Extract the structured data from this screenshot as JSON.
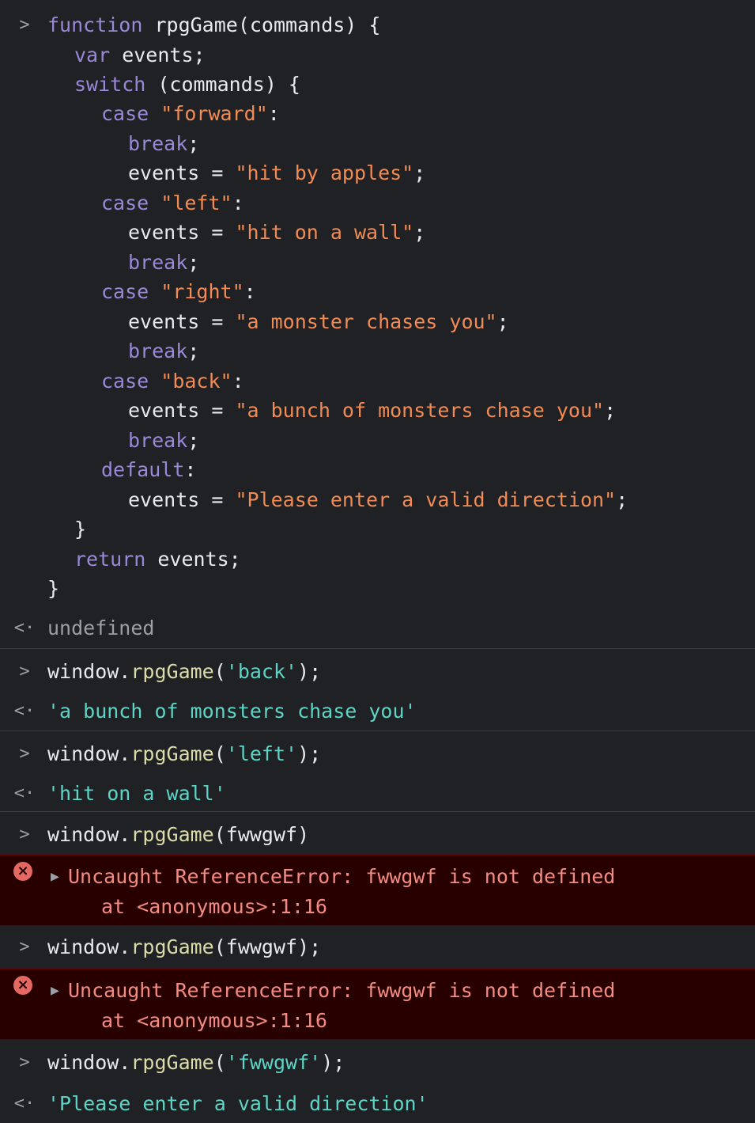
{
  "prompt_symbol": ">",
  "result_symbol": "<·",
  "error_icon": "×",
  "expand_triangle": "▶",
  "func": {
    "l0": {
      "kw": "function",
      "rest": " rpgGame(commands) {"
    },
    "l1": {
      "kw": "var",
      "rest": " events;"
    },
    "l2": {
      "kw": "switch",
      "rest": " (commands) {"
    },
    "l3": {
      "kw": "case",
      "str": "\"forward\"",
      "rest": ":"
    },
    "l4": {
      "kw": "break",
      "rest": ";"
    },
    "l5": {
      "pre": "events = ",
      "str": "\"hit by apples\"",
      "rest": ";"
    },
    "l6": {
      "kw": "case",
      "str": "\"left\"",
      "rest": ":"
    },
    "l7": {
      "pre": "events = ",
      "str": "\"hit on a wall\"",
      "rest": ";"
    },
    "l8": {
      "kw": "break",
      "rest": ";"
    },
    "l9": {
      "kw": "case",
      "str": "\"right\"",
      "rest": ":"
    },
    "l10": {
      "pre": "events = ",
      "str": "\"a monster chases you\"",
      "rest": ";"
    },
    "l11": {
      "kw": "break",
      "rest": ";"
    },
    "l12": {
      "kw": "case",
      "str": "\"back\"",
      "rest": ":"
    },
    "l13": {
      "pre": "events = ",
      "str": "\"a bunch of monsters chase you\"",
      "rest": ";"
    },
    "l14": {
      "kw": "break",
      "rest": ";"
    },
    "l15": {
      "kw": "default",
      "rest": ":"
    },
    "l16": {
      "pre": "events = ",
      "str": "\"Please enter a valid direction\"",
      "rest": ";"
    },
    "l17": {
      "rest": "}"
    },
    "l18": {
      "kw": "return",
      "rest": " events;"
    },
    "l19": {
      "rest": "}"
    },
    "result": "undefined"
  },
  "cmd_back": {
    "obj": "window.",
    "meth": "rpgGame",
    "open": "(",
    "arg": "'back'",
    "close": ");",
    "result": "'a bunch of monsters chase you'"
  },
  "cmd_left": {
    "obj": "window.",
    "meth": "rpgGame",
    "open": "(",
    "arg": "'left'",
    "close": ");",
    "result": "'hit on a wall'"
  },
  "cmd_err1": {
    "obj": "window.",
    "meth": "rpgGame",
    "rest": "(fwwgwf)",
    "error": "Uncaught ReferenceError: fwwgwf is not defined",
    "at": "at <anonymous>:1:16"
  },
  "cmd_err2": {
    "obj": "window.",
    "meth": "rpgGame",
    "rest": "(fwwgwf);",
    "error": "Uncaught ReferenceError: fwwgwf is not defined",
    "at": "at <anonymous>:1:16"
  },
  "cmd_fw": {
    "obj": "window.",
    "meth": "rpgGame",
    "open": "(",
    "arg": "'fwwgwf'",
    "close": ");",
    "result": "'Please enter a valid direction'"
  }
}
